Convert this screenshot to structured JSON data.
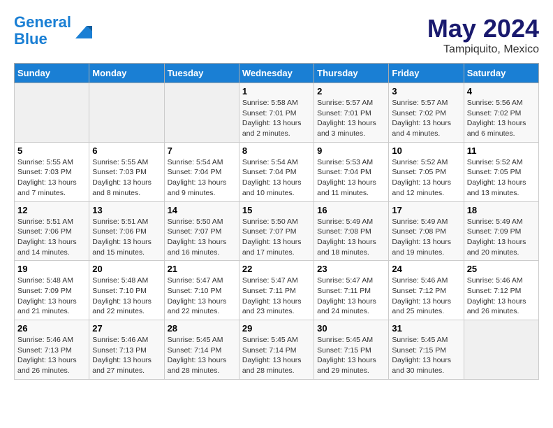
{
  "logo": {
    "line1": "General",
    "line2": "Blue"
  },
  "title": "May 2024",
  "subtitle": "Tampiquito, Mexico",
  "headers": [
    "Sunday",
    "Monday",
    "Tuesday",
    "Wednesday",
    "Thursday",
    "Friday",
    "Saturday"
  ],
  "weeks": [
    [
      {
        "day": "",
        "info": ""
      },
      {
        "day": "",
        "info": ""
      },
      {
        "day": "",
        "info": ""
      },
      {
        "day": "1",
        "info": "Sunrise: 5:58 AM\nSunset: 7:01 PM\nDaylight: 13 hours and 2 minutes."
      },
      {
        "day": "2",
        "info": "Sunrise: 5:57 AM\nSunset: 7:01 PM\nDaylight: 13 hours and 3 minutes."
      },
      {
        "day": "3",
        "info": "Sunrise: 5:57 AM\nSunset: 7:02 PM\nDaylight: 13 hours and 4 minutes."
      },
      {
        "day": "4",
        "info": "Sunrise: 5:56 AM\nSunset: 7:02 PM\nDaylight: 13 hours and 6 minutes."
      }
    ],
    [
      {
        "day": "5",
        "info": "Sunrise: 5:55 AM\nSunset: 7:03 PM\nDaylight: 13 hours and 7 minutes."
      },
      {
        "day": "6",
        "info": "Sunrise: 5:55 AM\nSunset: 7:03 PM\nDaylight: 13 hours and 8 minutes."
      },
      {
        "day": "7",
        "info": "Sunrise: 5:54 AM\nSunset: 7:04 PM\nDaylight: 13 hours and 9 minutes."
      },
      {
        "day": "8",
        "info": "Sunrise: 5:54 AM\nSunset: 7:04 PM\nDaylight: 13 hours and 10 minutes."
      },
      {
        "day": "9",
        "info": "Sunrise: 5:53 AM\nSunset: 7:04 PM\nDaylight: 13 hours and 11 minutes."
      },
      {
        "day": "10",
        "info": "Sunrise: 5:52 AM\nSunset: 7:05 PM\nDaylight: 13 hours and 12 minutes."
      },
      {
        "day": "11",
        "info": "Sunrise: 5:52 AM\nSunset: 7:05 PM\nDaylight: 13 hours and 13 minutes."
      }
    ],
    [
      {
        "day": "12",
        "info": "Sunrise: 5:51 AM\nSunset: 7:06 PM\nDaylight: 13 hours and 14 minutes."
      },
      {
        "day": "13",
        "info": "Sunrise: 5:51 AM\nSunset: 7:06 PM\nDaylight: 13 hours and 15 minutes."
      },
      {
        "day": "14",
        "info": "Sunrise: 5:50 AM\nSunset: 7:07 PM\nDaylight: 13 hours and 16 minutes."
      },
      {
        "day": "15",
        "info": "Sunrise: 5:50 AM\nSunset: 7:07 PM\nDaylight: 13 hours and 17 minutes."
      },
      {
        "day": "16",
        "info": "Sunrise: 5:49 AM\nSunset: 7:08 PM\nDaylight: 13 hours and 18 minutes."
      },
      {
        "day": "17",
        "info": "Sunrise: 5:49 AM\nSunset: 7:08 PM\nDaylight: 13 hours and 19 minutes."
      },
      {
        "day": "18",
        "info": "Sunrise: 5:49 AM\nSunset: 7:09 PM\nDaylight: 13 hours and 20 minutes."
      }
    ],
    [
      {
        "day": "19",
        "info": "Sunrise: 5:48 AM\nSunset: 7:09 PM\nDaylight: 13 hours and 21 minutes."
      },
      {
        "day": "20",
        "info": "Sunrise: 5:48 AM\nSunset: 7:10 PM\nDaylight: 13 hours and 22 minutes."
      },
      {
        "day": "21",
        "info": "Sunrise: 5:47 AM\nSunset: 7:10 PM\nDaylight: 13 hours and 22 minutes."
      },
      {
        "day": "22",
        "info": "Sunrise: 5:47 AM\nSunset: 7:11 PM\nDaylight: 13 hours and 23 minutes."
      },
      {
        "day": "23",
        "info": "Sunrise: 5:47 AM\nSunset: 7:11 PM\nDaylight: 13 hours and 24 minutes."
      },
      {
        "day": "24",
        "info": "Sunrise: 5:46 AM\nSunset: 7:12 PM\nDaylight: 13 hours and 25 minutes."
      },
      {
        "day": "25",
        "info": "Sunrise: 5:46 AM\nSunset: 7:12 PM\nDaylight: 13 hours and 26 minutes."
      }
    ],
    [
      {
        "day": "26",
        "info": "Sunrise: 5:46 AM\nSunset: 7:13 PM\nDaylight: 13 hours and 26 minutes."
      },
      {
        "day": "27",
        "info": "Sunrise: 5:46 AM\nSunset: 7:13 PM\nDaylight: 13 hours and 27 minutes."
      },
      {
        "day": "28",
        "info": "Sunrise: 5:45 AM\nSunset: 7:14 PM\nDaylight: 13 hours and 28 minutes."
      },
      {
        "day": "29",
        "info": "Sunrise: 5:45 AM\nSunset: 7:14 PM\nDaylight: 13 hours and 28 minutes."
      },
      {
        "day": "30",
        "info": "Sunrise: 5:45 AM\nSunset: 7:15 PM\nDaylight: 13 hours and 29 minutes."
      },
      {
        "day": "31",
        "info": "Sunrise: 5:45 AM\nSunset: 7:15 PM\nDaylight: 13 hours and 30 minutes."
      },
      {
        "day": "",
        "info": ""
      }
    ]
  ]
}
